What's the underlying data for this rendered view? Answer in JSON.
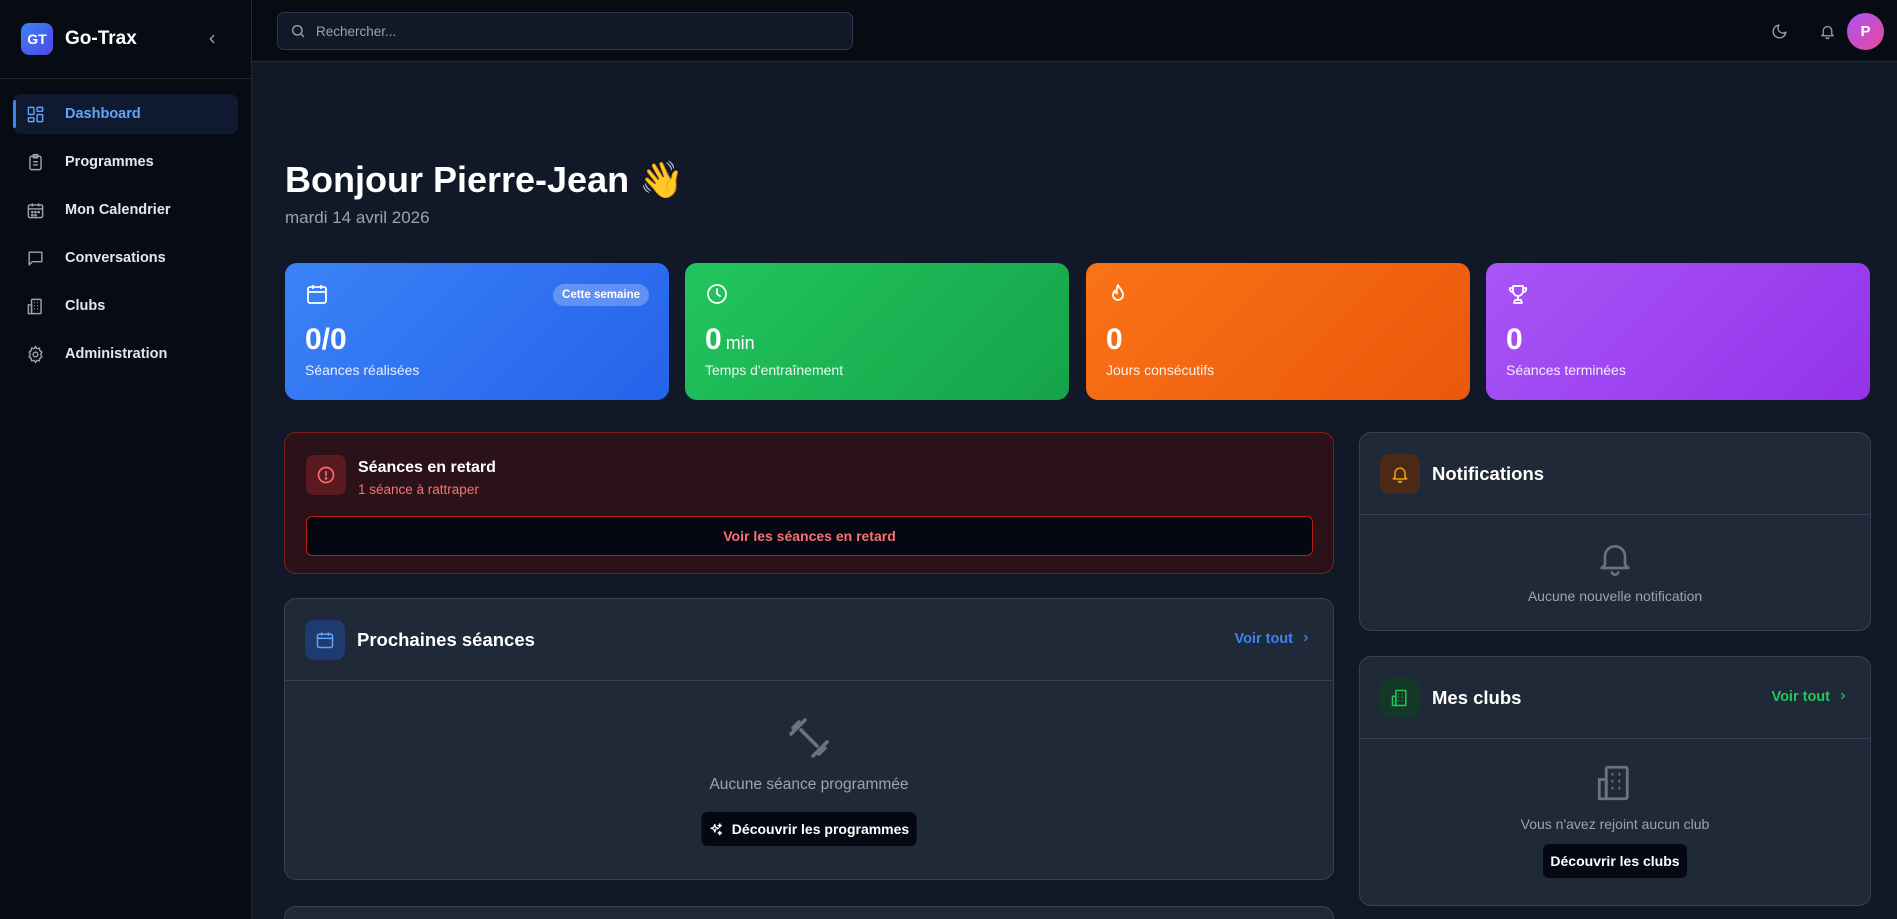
{
  "app": {
    "logo_text": "GT",
    "name": "Go-Trax"
  },
  "sidebar": {
    "items": [
      {
        "label": "Dashboard",
        "icon": "dashboard-icon",
        "active": true
      },
      {
        "label": "Programmes",
        "icon": "clipboard-icon"
      },
      {
        "label": "Mon Calendrier",
        "icon": "calendar-icon"
      },
      {
        "label": "Conversations",
        "icon": "chat-icon"
      },
      {
        "label": "Clubs",
        "icon": "building-icon"
      },
      {
        "label": "Administration",
        "icon": "gear-icon"
      }
    ]
  },
  "topbar": {
    "search_placeholder": "Rechercher...",
    "avatar_initial": "P"
  },
  "main": {
    "greeting": "Bonjour Pierre-Jean 👋",
    "date": "mardi 14 avril 2026"
  },
  "stats": [
    {
      "value": "0/0",
      "unit": "",
      "label": "Séances réalisées",
      "badge": "Cette semaine",
      "icon": "calendar-icon",
      "color_from": "#3b82f6",
      "color_to": "#2563eb"
    },
    {
      "value": "0",
      "unit": "min",
      "label": "Temps d'entraînement",
      "icon": "clock-icon",
      "color_from": "#22c55e",
      "color_to": "#16a34a"
    },
    {
      "value": "0",
      "unit": "",
      "label": "Jours consécutifs",
      "icon": "flame-icon",
      "color_from": "#f97316",
      "color_to": "#ea580c"
    },
    {
      "value": "0",
      "unit": "",
      "label": "Séances terminées",
      "icon": "trophy-icon",
      "color_from": "#a855f7",
      "color_to": "#9333ea"
    }
  ],
  "overdue": {
    "title": "Séances en retard",
    "subtitle": "1 séance à rattraper",
    "button": "Voir les séances en retard"
  },
  "upcoming": {
    "title": "Prochaines séances",
    "see_all": "Voir tout",
    "empty_text": "Aucune séance programmée",
    "button": "Découvrir les programmes"
  },
  "notifications": {
    "title": "Notifications",
    "empty_text": "Aucune nouvelle notification"
  },
  "clubs": {
    "title": "Mes clubs",
    "see_all": "Voir tout",
    "empty_text": "Vous n'avez rejoint aucun club",
    "button": "Découvrir les clubs"
  },
  "colors": {
    "accent_blue": "#3b82f6",
    "accent_green": "#22c55e",
    "danger": "#f87171"
  }
}
